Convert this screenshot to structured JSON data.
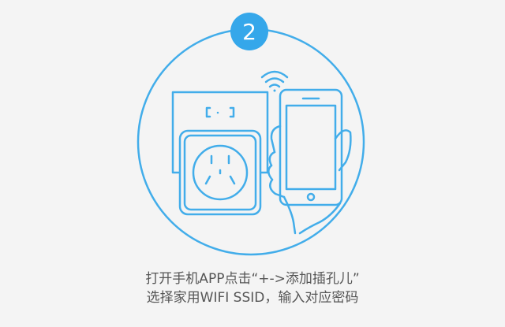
{
  "step": {
    "number": "2"
  },
  "colors": {
    "accent": "#35a7ea",
    "line": "#42adea",
    "background": "#f4f4f4",
    "text": "#555555"
  },
  "icons": [
    "step-badge",
    "wifi-icon",
    "smart-plug-icon",
    "wall-outlet-icon",
    "smartphone-icon",
    "hand-icon"
  ],
  "instruction": {
    "line1": "打开手机APP点击“+->添加插孔儿”",
    "line2": "选择家用WIFI SSID，输入对应密码"
  }
}
